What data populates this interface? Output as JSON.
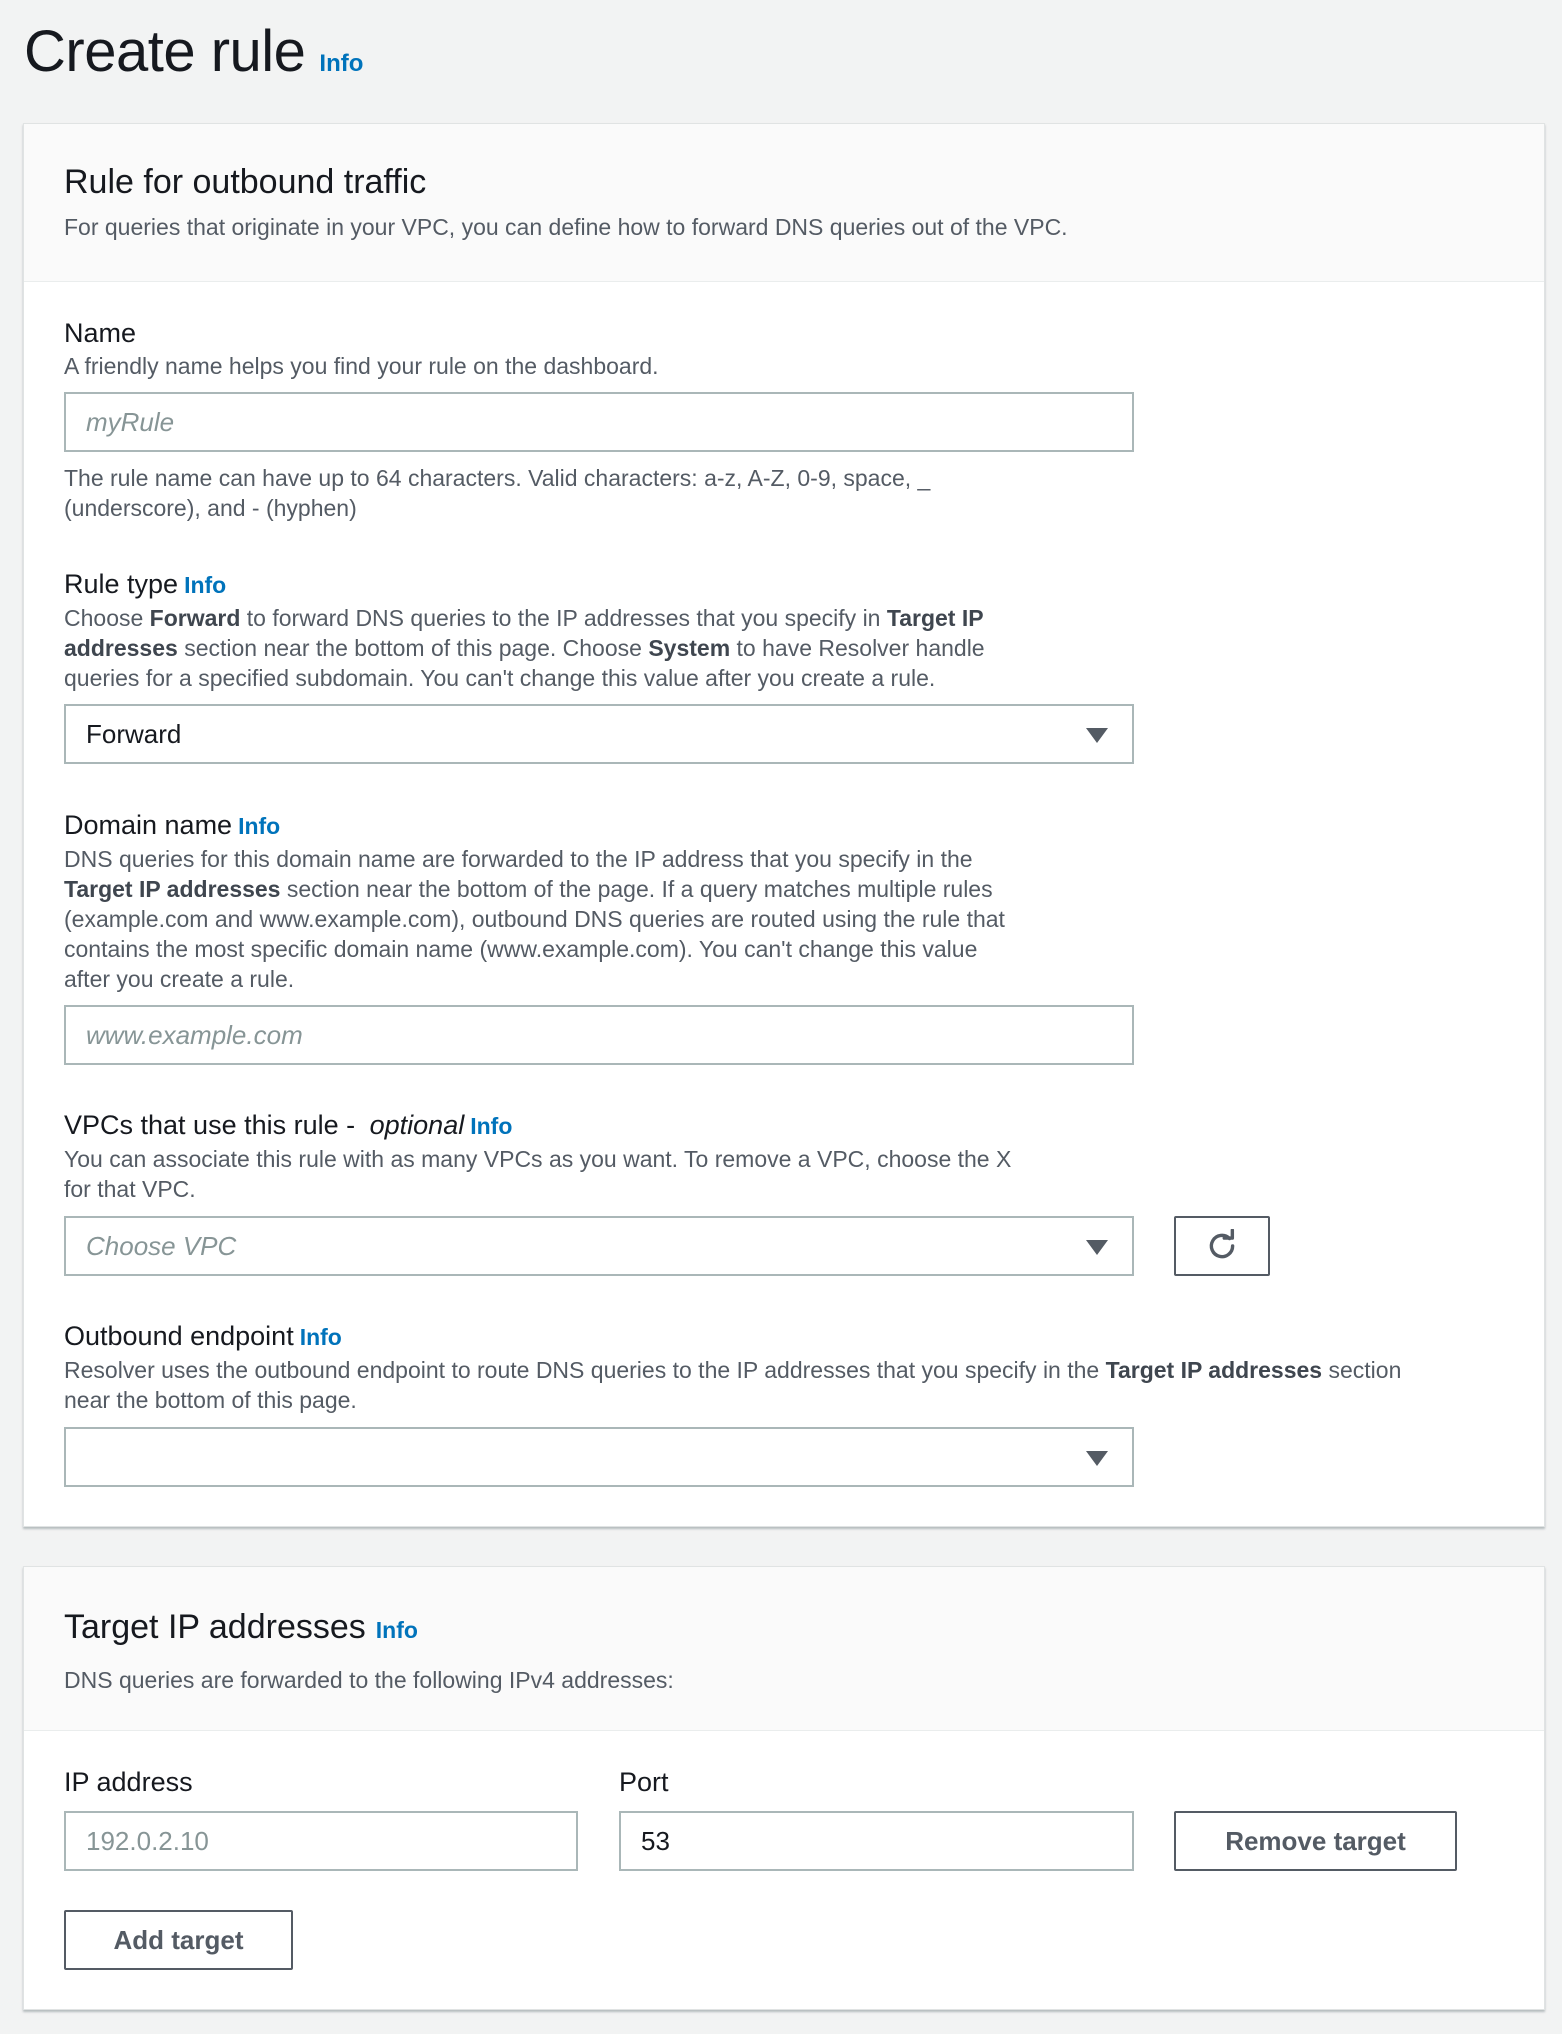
{
  "page": {
    "title": "Create rule",
    "info": "Info"
  },
  "outbound": {
    "title": "Rule for outbound traffic",
    "description": "For queries that originate in your VPC, you can define how to forward DNS queries out of the VPC."
  },
  "name_field": {
    "label": "Name",
    "description": "A friendly name helps you find your rule on the dashboard.",
    "placeholder": "myRule",
    "value": "",
    "hint_line1": "The rule name can have up to 64 characters. Valid characters: a-z, A-Z, 0-9, space, _",
    "hint_line2": "(underscore), and - (hyphen)"
  },
  "rule_type": {
    "label": "Rule type",
    "info": "Info",
    "desc": {
      "p1": "Choose ",
      "forward": "Forward",
      "p2": " to forward DNS queries to the IP addresses that you specify in ",
      "target1": "Target IP",
      "target2": "addresses",
      "p3": " section near the bottom of this page. Choose ",
      "system": "System",
      "p4": " to have Resolver handle",
      "p5": "queries for a specified subdomain. You can't change this value after you create a rule."
    },
    "selected": "Forward"
  },
  "domain_name": {
    "label": "Domain name",
    "info": "Info",
    "desc": {
      "l1": "DNS queries for this domain name are forwarded to the IP address that you specify in the",
      "l2_bold": "Target IP addresses",
      "l2": " section near the bottom of the page. If a query matches multiple rules",
      "l3": "(example.com and www.example.com), outbound DNS queries are routed using the rule that",
      "l4": "contains the most specific domain name (www.example.com). You can't change this value",
      "l5": "after you create a rule."
    },
    "placeholder": "www.example.com"
  },
  "vpcs": {
    "label": "VPCs that use this rule - ",
    "optional": "optional",
    "info": "Info",
    "desc_line1": "You can associate this rule with as many VPCs as you want. To remove a VPC, choose the X",
    "desc_line2": "for that VPC.",
    "placeholder": "Choose VPC"
  },
  "outbound_endpoint": {
    "label": "Outbound endpoint",
    "info": "Info",
    "desc": {
      "p1": "Resolver uses the outbound endpoint to route DNS queries to the IP addresses that you specify in the ",
      "bold": "Target IP addresses",
      "p2": " section",
      "l2": "near the bottom of this page."
    },
    "selected": ""
  },
  "targets": {
    "title": "Target IP addresses",
    "info": "Info",
    "description": "DNS queries are forwarded to the following IPv4 addresses:",
    "ip_label": "IP address",
    "port_label": "Port",
    "ip_placeholder": "192.0.2.10",
    "port_value": "53",
    "remove_label": "Remove target",
    "add_label": "Add target"
  },
  "icons": {
    "refresh": "refresh-icon",
    "dropdown": "caret-down-icon"
  },
  "colors": {
    "link": "#0073bb",
    "background": "#f2f3f3",
    "border": "#aab7b8",
    "button": "#545b64"
  }
}
